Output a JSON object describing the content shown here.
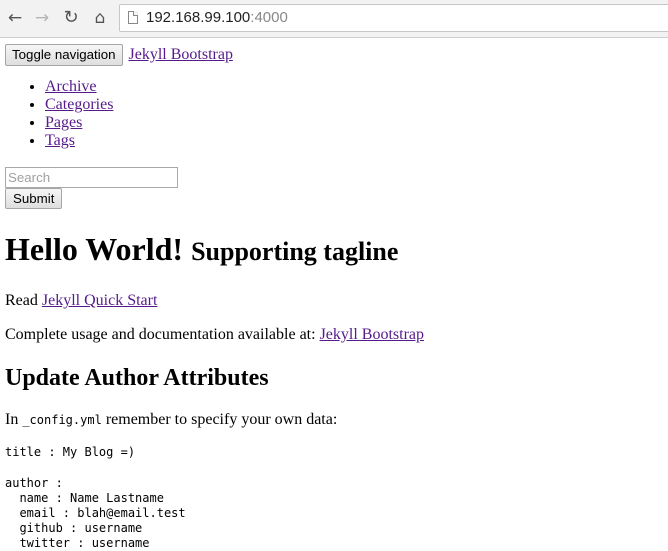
{
  "browser": {
    "back_icon": "back-arrow-icon",
    "forward_icon": "forward-arrow-icon",
    "reload_icon": "reload-icon",
    "home_icon": "home-icon",
    "url_host": "192.168.99.100",
    "url_port": ":4000"
  },
  "navbar": {
    "toggle_label": "Toggle navigation",
    "brand": "Jekyll Bootstrap",
    "items": [
      {
        "label": "Archive"
      },
      {
        "label": "Categories"
      },
      {
        "label": "Pages"
      },
      {
        "label": "Tags"
      }
    ]
  },
  "search": {
    "placeholder": "Search",
    "submit_label": "Submit"
  },
  "main": {
    "title": "Hello World!",
    "tagline": "Supporting tagline",
    "read_prefix": "Read",
    "quick_start_link": "Jekyll Quick Start",
    "docs_text": "Complete usage and documentation available at:",
    "docs_link": "Jekyll Bootstrap",
    "section_heading": "Update Author Attributes",
    "config_prefix": "In",
    "config_file": "_config.yml",
    "config_suffix": "remember to specify your own data:",
    "code_block_1": "title : My Blog =)",
    "code_block_2": "author :\n  name : Name Lastname\n  email : blah@email.test\n  github : username\n  twitter : username"
  }
}
